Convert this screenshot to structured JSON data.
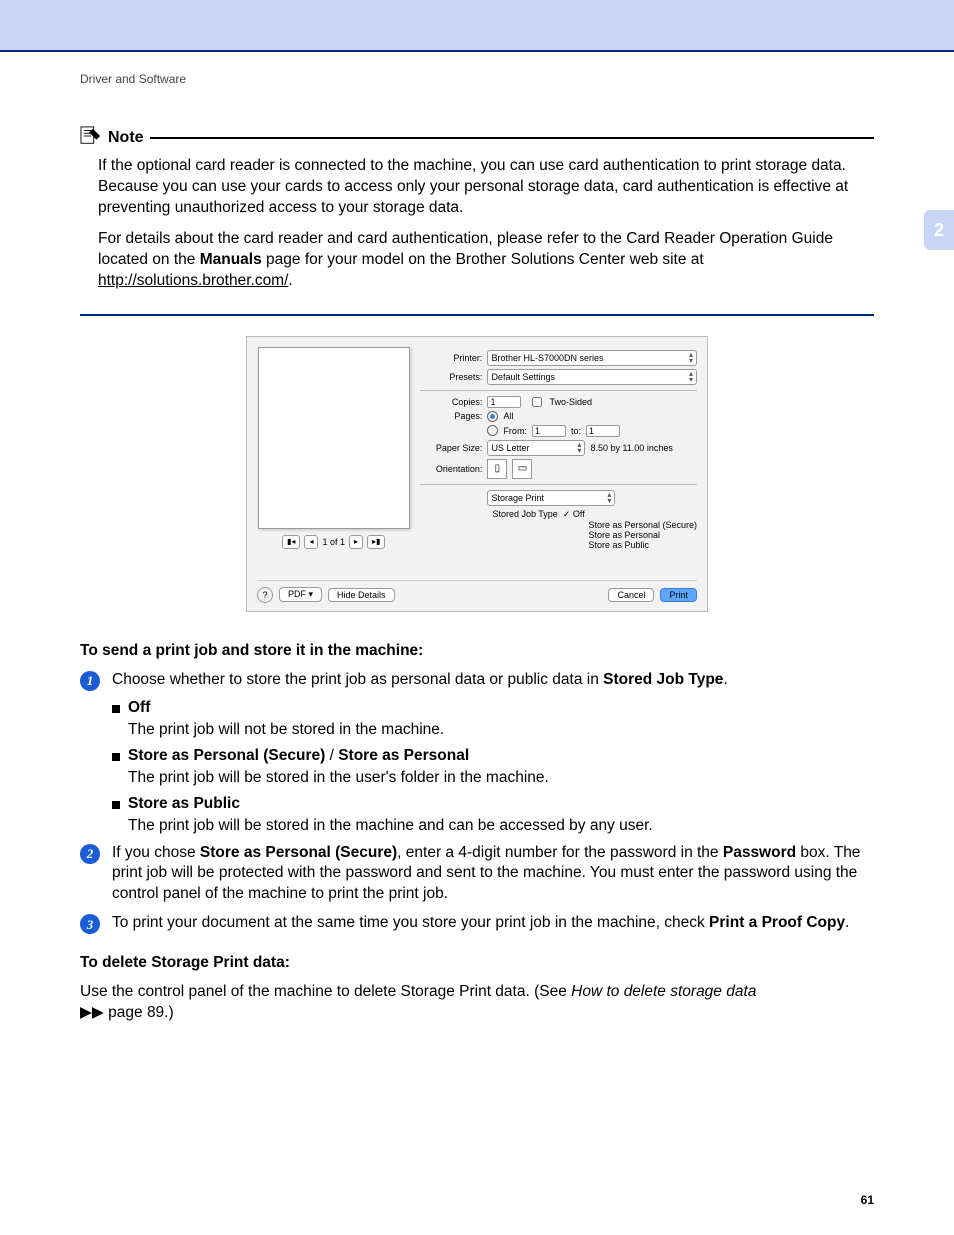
{
  "header": {
    "section": "Driver and Software"
  },
  "sideTab": "2",
  "note": {
    "label": "Note",
    "para1": "If the optional card reader is connected to the machine, you can use card authentication to print storage data. Because you can use your cards to access only your personal storage data, card authentication is effective at preventing unauthorized access to your storage data.",
    "para2a": "For details about the card reader and card authentication, please refer to the Card Reader Operation Guide located on the ",
    "para2bold": "Manuals",
    "para2b": " page for your model on the Brother Solutions Center web site at ",
    "para2link": "http://solutions.brother.com/",
    "para2end": "."
  },
  "dialog": {
    "printerLabel": "Printer:",
    "printerValue": "Brother HL-S7000DN series",
    "presetsLabel": "Presets:",
    "presetsValue": "Default Settings",
    "copiesLabel": "Copies:",
    "copiesValue": "1",
    "twoSided": "Two-Sided",
    "pagesLabel": "Pages:",
    "pagesAll": "All",
    "pagesFrom": "From:",
    "pagesFromVal": "1",
    "pagesTo": "to:",
    "pagesToVal": "1",
    "paperSizeLabel": "Paper Size:",
    "paperSizeValue": "US Letter",
    "paperDims": "8.50 by 11.00 inches",
    "orientationLabel": "Orientation:",
    "sectionSelect": "Storage Print",
    "storedJobTypeLabel": "Stored Job Type",
    "menu": {
      "off": "Off",
      "secure": "Store as Personal (Secure)",
      "personal": "Store as Personal",
      "public": "Store as Public"
    },
    "pageNav": "1 of 1",
    "pdf": "PDF",
    "hideDetails": "Hide Details",
    "cancel": "Cancel",
    "print": "Print"
  },
  "instr": {
    "heading1": "To send a print job and store it in the machine:",
    "step1a": "Choose whether to store the print job as personal data or public data in ",
    "step1bold": "Stored Job Type",
    "opt1t": "Off",
    "opt1d": "The print job will not be stored in the machine.",
    "opt2t": "Store as Personal (Secure)",
    "opt2sep": " / ",
    "opt2t2": "Store as Personal",
    "opt2d": "The print job will be stored in the user's folder in the machine.",
    "opt3t": "Store as Public",
    "opt3d": "The print job will be stored in the machine and can be accessed by any user.",
    "step2a": "If you chose ",
    "step2b": "Store as Personal (Secure)",
    "step2c": ", enter a 4-digit number for the password in the ",
    "step2d": "Password",
    "step2e": " box. The print job will be protected with the password and sent to the machine. You must enter the password using the control panel of the machine to print the print job.",
    "step3a": "To print your document at the same time you store your print job in the machine, check ",
    "step3b": "Print a Proof Copy",
    "heading2": "To delete Storage Print data:",
    "deleteTextA": "Use the control panel of the machine to delete Storage Print data. (See ",
    "deleteTextItalic": "How to delete storage data",
    "deleteTextB": " page 89.)"
  },
  "pageNumber": "61"
}
